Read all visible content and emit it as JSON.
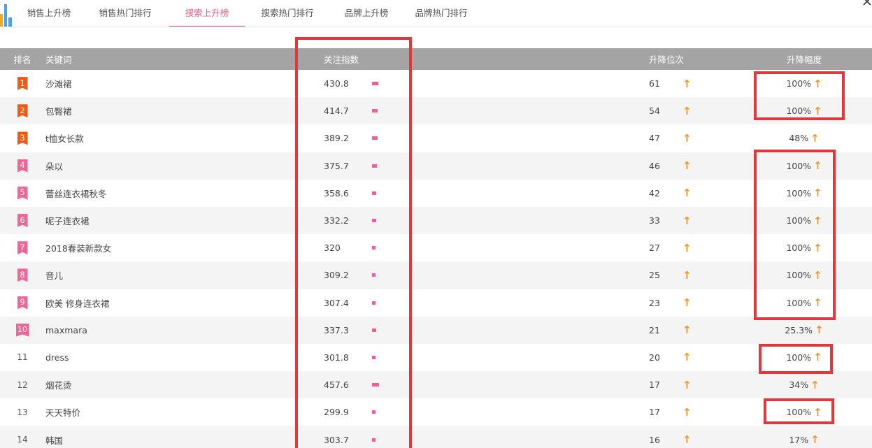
{
  "tabs": [
    {
      "label": "销售上升榜",
      "active": false
    },
    {
      "label": "销售热门排行",
      "active": false
    },
    {
      "label": "搜索上升榜",
      "active": true
    },
    {
      "label": "搜索热门排行",
      "active": false
    },
    {
      "label": "品牌上升榜",
      "active": false
    },
    {
      "label": "品牌热门排行",
      "active": false
    }
  ],
  "close_icon": "close-icon",
  "colors": {
    "accent_pink": "#e8588a",
    "rank_top": "#f05a13",
    "rank_mid": "#ee6696",
    "bar": "#ee5f93",
    "arrow": "#f29423",
    "highlight": "#e2383d",
    "header_bg": "#a4a4a4"
  },
  "table": {
    "headers": {
      "rank": "排名",
      "keyword": "关键词",
      "index": "关注指数",
      "position": "升降位次",
      "change": "升降幅度"
    },
    "rows": [
      {
        "rank": "1",
        "keyword": "沙滩裙",
        "index": "430.8",
        "position": "61",
        "change": "100%"
      },
      {
        "rank": "2",
        "keyword": "包臀裙",
        "index": "414.7",
        "position": "54",
        "change": "100%"
      },
      {
        "rank": "3",
        "keyword": "t恤女长款",
        "index": "389.2",
        "position": "47",
        "change": "48%"
      },
      {
        "rank": "4",
        "keyword": "朵以",
        "index": "375.7",
        "position": "46",
        "change": "100%"
      },
      {
        "rank": "5",
        "keyword": "蕾丝连衣裙秋冬",
        "index": "358.6",
        "position": "42",
        "change": "100%"
      },
      {
        "rank": "6",
        "keyword": "呢子连衣裙",
        "index": "332.2",
        "position": "33",
        "change": "100%"
      },
      {
        "rank": "7",
        "keyword": "2018春装新款女",
        "index": "320",
        "position": "27",
        "change": "100%"
      },
      {
        "rank": "8",
        "keyword": "音儿",
        "index": "309.2",
        "position": "25",
        "change": "100%"
      },
      {
        "rank": "9",
        "keyword": "欧美 修身连衣裙",
        "index": "307.4",
        "position": "23",
        "change": "100%"
      },
      {
        "rank": "10",
        "keyword": "maxmara",
        "index": "337.3",
        "position": "21",
        "change": "25.3%"
      },
      {
        "rank": "11",
        "keyword": "dress",
        "index": "301.8",
        "position": "20",
        "change": "100%"
      },
      {
        "rank": "12",
        "keyword": "烟花烫",
        "index": "457.6",
        "position": "17",
        "change": "34%"
      },
      {
        "rank": "13",
        "keyword": "天天特价",
        "index": "299.9",
        "position": "17",
        "change": "100%"
      },
      {
        "rank": "14",
        "keyword": "韩国",
        "index": "303.7",
        "position": "16",
        "change": "17%"
      }
    ]
  }
}
